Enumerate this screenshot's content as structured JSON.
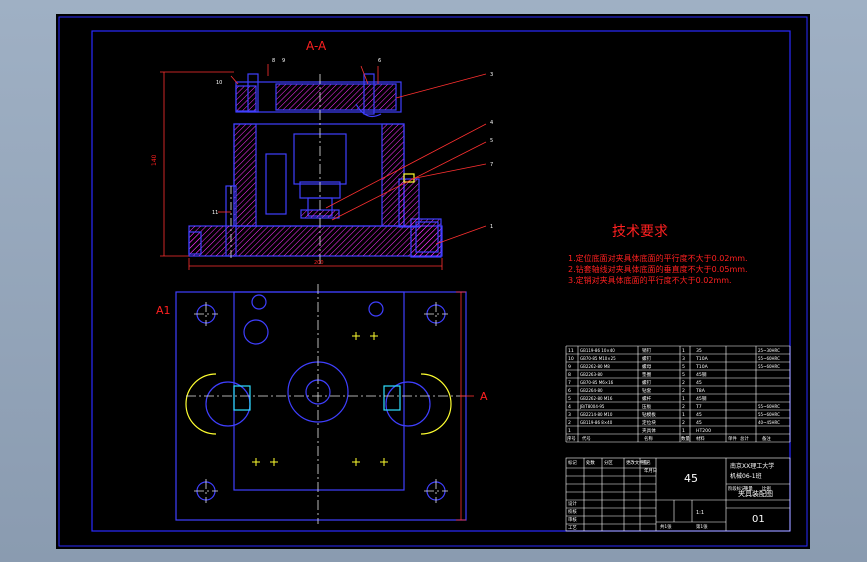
{
  "section_label": "A-A",
  "view_label_left": "A1",
  "view_label_right": "A",
  "dim_width": "200",
  "dim_height": "140",
  "callouts": [
    "10",
    "8",
    "9",
    "3",
    "4",
    "5",
    "7",
    "11",
    "1",
    "6"
  ],
  "tech_req": {
    "title": "技术要求",
    "lines": [
      "1.定位底面对夹具体底面的平行度不大于0.02mm.",
      "2.钻套轴线对夹具体底面的垂直度不大于0.05mm.",
      "3.定销对夹具体底面的平行度不大于0.02mm."
    ]
  },
  "bom": {
    "rows": [
      {
        "no": "11",
        "code": "GB119-86 10×40",
        "name": "销钉",
        "qty": "1",
        "mat": "35",
        "note": "25~30HRC"
      },
      {
        "no": "10",
        "code": "GB70-85 M10×25",
        "name": "螺钉",
        "qty": "3",
        "mat": "T10A",
        "note": "55~60HRC"
      },
      {
        "no": "9",
        "code": "GB2262-80 M8",
        "name": "螺母",
        "qty": "5",
        "mat": "T10A",
        "note": "55~60HRC"
      },
      {
        "no": "8",
        "code": "GB2263-80",
        "name": "垫圈",
        "qty": "5",
        "mat": "45钢",
        "note": ""
      },
      {
        "no": "7",
        "code": "GB70-85 M6×16",
        "name": "螺钉",
        "qty": "2",
        "mat": "45",
        "note": ""
      },
      {
        "no": "6",
        "code": "GB2264-80",
        "name": "钻套",
        "qty": "2",
        "mat": "T8A",
        "note": ""
      },
      {
        "no": "5",
        "code": "GB2262-80 M16",
        "name": "螺杆",
        "qty": "1",
        "mat": "45钢",
        "note": ""
      },
      {
        "no": "4",
        "code": "JB/T8004-95",
        "name": "压板",
        "qty": "2",
        "mat": "T7",
        "note": "55~60HRC"
      },
      {
        "no": "3",
        "code": "GB2214-80 M10",
        "name": "钻模板",
        "qty": "1",
        "mat": "45",
        "note": "55~60HRC"
      },
      {
        "no": "2",
        "code": "GB119-86 8×40",
        "name": "定位块",
        "qty": "2",
        "mat": "45",
        "note": "40~45HRC"
      },
      {
        "no": "1",
        "code": "",
        "name": "夹具体",
        "qty": "1",
        "mat": "HT200",
        "note": ""
      }
    ],
    "header": [
      "序号",
      "代号",
      "名称",
      "数量",
      "材料",
      "单件",
      "总计",
      "备注"
    ]
  },
  "title_block": {
    "material": "45",
    "school": "南京XX理工大学",
    "class": "机械06-1班",
    "drawing_name": "夹具装配图",
    "drawing_no": "01",
    "scale": "1:1",
    "labels": [
      "设计",
      "校核",
      "审核",
      "工艺",
      "标记",
      "处数",
      "分区",
      "更改文件号",
      "签名",
      "年月日",
      "阶段标记",
      "重量",
      "比例",
      "共1张",
      "第1张"
    ]
  },
  "colors": {
    "frame": "#2a2aff",
    "outline": "#3f3fff",
    "hatch": "#ff2fff",
    "center": "#e6e6e6",
    "text_red": "#ff2020",
    "leader": "#ff3030",
    "cyan": "#2fe0ff",
    "yellow": "#ffff30",
    "white": "#ffffff"
  }
}
